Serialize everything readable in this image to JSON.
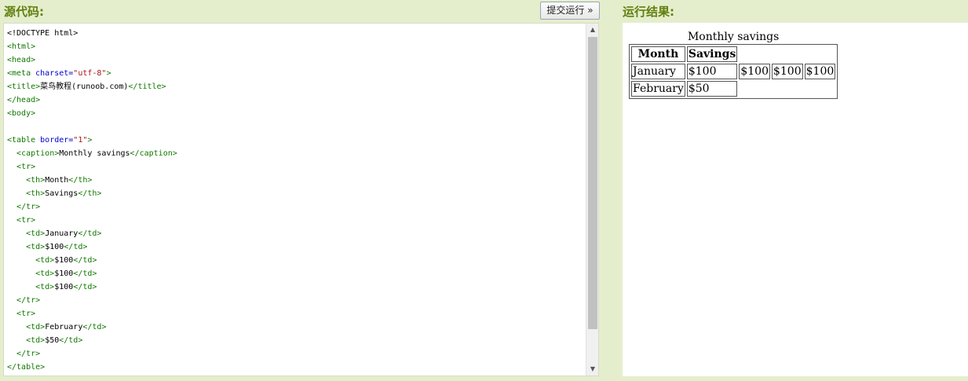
{
  "source_panel": {
    "title": "源代码:",
    "run_button_label": "提交运行 »"
  },
  "result_panel": {
    "title": "运行结果:"
  },
  "code_lines": [
    [
      {
        "t": "plain",
        "s": "<!DOCTYPE html>"
      }
    ],
    [
      {
        "t": "tag",
        "s": "<html>"
      }
    ],
    [
      {
        "t": "tag",
        "s": "<head>"
      }
    ],
    [
      {
        "t": "tag",
        "s": "<meta "
      },
      {
        "t": "attr",
        "s": "charset="
      },
      {
        "t": "str",
        "s": "\"utf-8\""
      },
      {
        "t": "tag",
        "s": ">"
      }
    ],
    [
      {
        "t": "tag",
        "s": "<title>"
      },
      {
        "t": "plain",
        "s": "菜鸟教程(runoob.com)"
      },
      {
        "t": "tag",
        "s": "</title>"
      }
    ],
    [
      {
        "t": "tag",
        "s": "</head>"
      }
    ],
    [
      {
        "t": "tag",
        "s": "<body>"
      }
    ],
    [],
    [
      {
        "t": "tag",
        "s": "<table "
      },
      {
        "t": "attr",
        "s": "border="
      },
      {
        "t": "str",
        "s": "\"1\""
      },
      {
        "t": "tag",
        "s": ">"
      }
    ],
    [
      {
        "t": "plain",
        "s": "  "
      },
      {
        "t": "tag",
        "s": "<caption>"
      },
      {
        "t": "plain",
        "s": "Monthly savings"
      },
      {
        "t": "tag",
        "s": "</caption>"
      }
    ],
    [
      {
        "t": "plain",
        "s": "  "
      },
      {
        "t": "tag",
        "s": "<tr>"
      }
    ],
    [
      {
        "t": "plain",
        "s": "    "
      },
      {
        "t": "tag",
        "s": "<th>"
      },
      {
        "t": "plain",
        "s": "Month"
      },
      {
        "t": "tag",
        "s": "</th>"
      }
    ],
    [
      {
        "t": "plain",
        "s": "    "
      },
      {
        "t": "tag",
        "s": "<th>"
      },
      {
        "t": "plain",
        "s": "Savings"
      },
      {
        "t": "tag",
        "s": "</th>"
      }
    ],
    [
      {
        "t": "plain",
        "s": "  "
      },
      {
        "t": "tag",
        "s": "</tr>"
      }
    ],
    [
      {
        "t": "plain",
        "s": "  "
      },
      {
        "t": "tag",
        "s": "<tr>"
      }
    ],
    [
      {
        "t": "plain",
        "s": "    "
      },
      {
        "t": "tag",
        "s": "<td>"
      },
      {
        "t": "plain",
        "s": "January"
      },
      {
        "t": "tag",
        "s": "</td>"
      }
    ],
    [
      {
        "t": "plain",
        "s": "    "
      },
      {
        "t": "tag",
        "s": "<td>"
      },
      {
        "t": "plain",
        "s": "$100"
      },
      {
        "t": "tag",
        "s": "</td>"
      }
    ],
    [
      {
        "t": "plain",
        "s": "      "
      },
      {
        "t": "tag",
        "s": "<td>"
      },
      {
        "t": "plain",
        "s": "$100"
      },
      {
        "t": "tag",
        "s": "</td>"
      }
    ],
    [
      {
        "t": "plain",
        "s": "      "
      },
      {
        "t": "tag",
        "s": "<td>"
      },
      {
        "t": "plain",
        "s": "$100"
      },
      {
        "t": "tag",
        "s": "</td>"
      }
    ],
    [
      {
        "t": "plain",
        "s": "      "
      },
      {
        "t": "tag",
        "s": "<td>"
      },
      {
        "t": "plain",
        "s": "$100"
      },
      {
        "t": "tag",
        "s": "</td>"
      }
    ],
    [
      {
        "t": "plain",
        "s": "  "
      },
      {
        "t": "tag",
        "s": "</tr>"
      }
    ],
    [
      {
        "t": "plain",
        "s": "  "
      },
      {
        "t": "tag",
        "s": "<tr>"
      }
    ],
    [
      {
        "t": "plain",
        "s": "    "
      },
      {
        "t": "tag",
        "s": "<td>"
      },
      {
        "t": "plain",
        "s": "February"
      },
      {
        "t": "tag",
        "s": "</td>"
      }
    ],
    [
      {
        "t": "plain",
        "s": "    "
      },
      {
        "t": "tag",
        "s": "<td>"
      },
      {
        "t": "plain",
        "s": "$50"
      },
      {
        "t": "tag",
        "s": "</td>"
      }
    ],
    [
      {
        "t": "plain",
        "s": "  "
      },
      {
        "t": "tag",
        "s": "</tr>"
      }
    ],
    [
      {
        "t": "tag",
        "s": "</table>"
      }
    ]
  ],
  "result_table": {
    "caption": "Monthly savings",
    "headers": [
      "Month",
      "Savings"
    ],
    "rows": [
      [
        "January",
        "$100",
        "$100",
        "$100",
        "$100"
      ],
      [
        "February",
        "$50"
      ]
    ]
  },
  "icons": {
    "scroll_up": "scroll-up-arrow-icon",
    "scroll_down": "scroll-down-arrow-icon"
  },
  "colors": {
    "page_bg": "#e5eecc",
    "header_text": "#617f10",
    "tag": "#117700",
    "attr": "#0000cc",
    "string": "#aa1111"
  }
}
